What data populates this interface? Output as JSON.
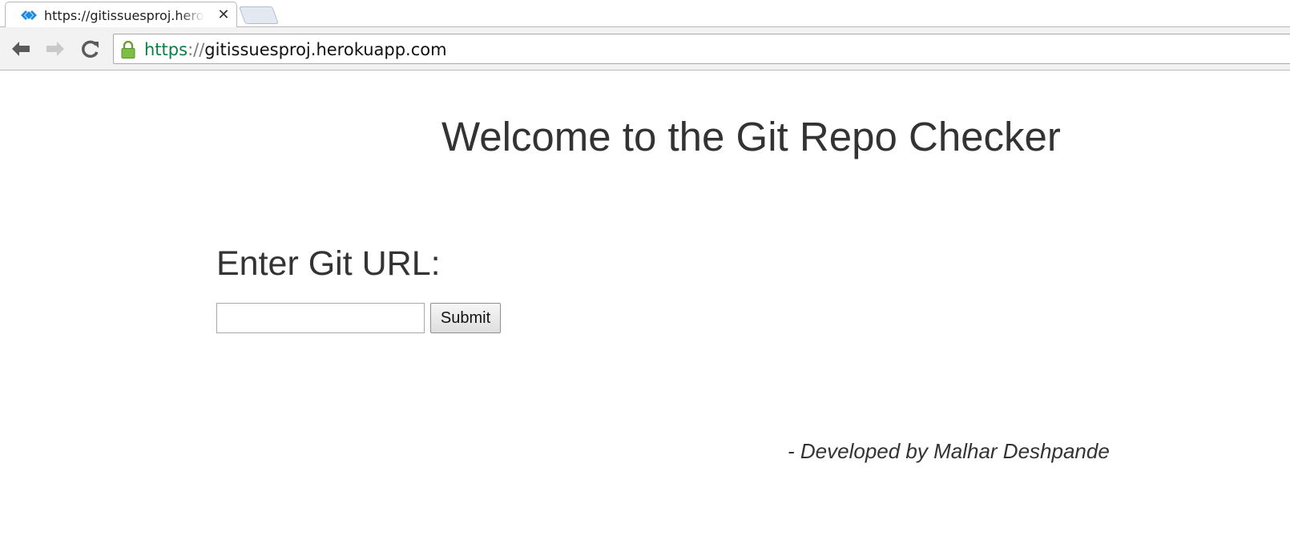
{
  "browser": {
    "tab": {
      "title": "https://gitissuesproj.herokuapp.com",
      "favicon": "heroku-diamond-icon",
      "close_symbol": "✕"
    },
    "address_bar": {
      "scheme": "https",
      "separator": "://",
      "host": "gitissuesproj.herokuapp.com",
      "secure": true
    },
    "nav_icons": [
      "back-arrow-icon",
      "forward-arrow-icon",
      "reload-icon"
    ]
  },
  "page": {
    "heading": "Welcome to the Git Repo Checker",
    "form": {
      "label": "Enter Git URL:",
      "input_value": "",
      "submit_label": "Submit"
    },
    "credit": "- Developed by Malhar Deshpande"
  },
  "colors": {
    "text": "#333333",
    "secure_green": "#0b8043",
    "chrome_toolbar": "#f2f2f2"
  }
}
